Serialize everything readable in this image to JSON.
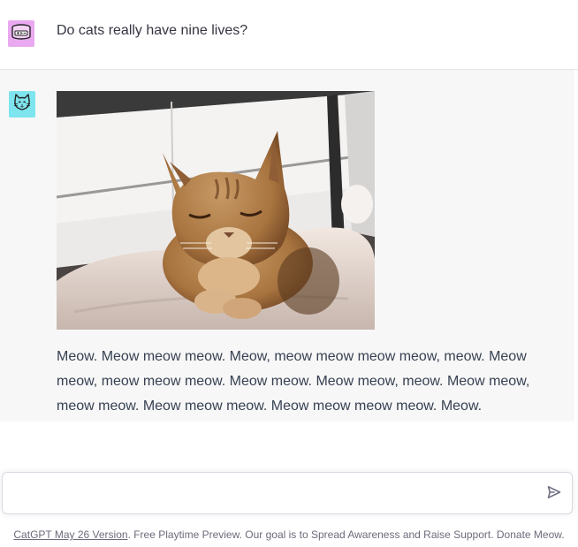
{
  "user_message": {
    "avatar_icon": "cat-food-can-icon",
    "avatar_color": "#e9a8f0",
    "text": "Do cats really have nine lives?"
  },
  "bot_message": {
    "avatar_icon": "cat-face-icon",
    "avatar_color": "#7ee4ee",
    "image_alt": "orange tabby cat resting on a cushion",
    "text": "Meow. Meow meow meow. Meow, meow meow meow meow, meow. Meow meow, meow meow meow. Meow meow. Meow meow, meow. Meow meow, meow meow. Meow meow meow. Meow meow meow meow. Meow."
  },
  "composer": {
    "placeholder": "",
    "value": "",
    "send_icon": "send-icon"
  },
  "footer": {
    "version_link": "CatGPT May 26 Version",
    "text": ". Free Playtime Preview. Our goal is to Spread Awareness and Raise Support. Donate Meow."
  },
  "colors": {
    "bot_background": "#f7f7f8",
    "text": "#343541",
    "footer_text": "#6b6c7b"
  }
}
